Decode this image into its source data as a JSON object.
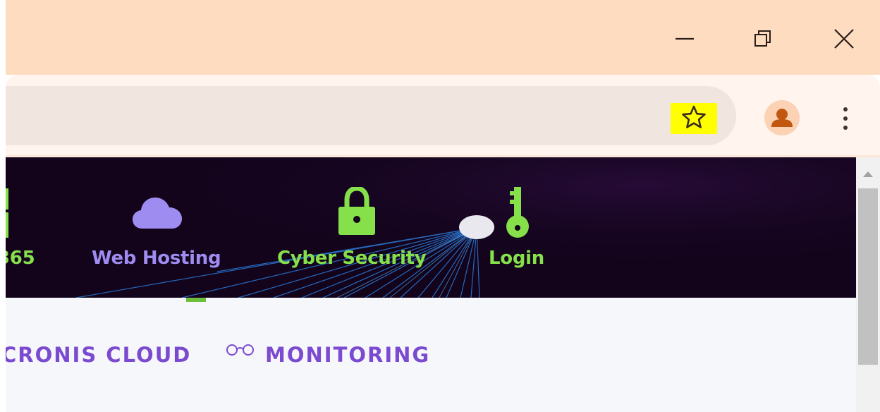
{
  "window_controls": {
    "minimize_icon": "minimize-icon",
    "restore_icon": "restore-icon",
    "close_icon": "close-icon"
  },
  "toolbar": {
    "bookmark_icon": "star-icon",
    "profile_icon": "profile-avatar-icon",
    "menu_icon": "kebab-menu-icon"
  },
  "nav": {
    "items": [
      {
        "label": "365",
        "icon": "grid-icon",
        "color": "#86e04a"
      },
      {
        "label": "Web Hosting",
        "icon": "cloud-icon",
        "color": "#9f8cf1"
      },
      {
        "label": "Cyber Security",
        "icon": "lock-icon",
        "color": "#86e04a"
      },
      {
        "label": "Login",
        "icon": "key-icon",
        "color": "#86e04a"
      }
    ]
  },
  "submenu": {
    "items": [
      {
        "label": "CRONIS CLOUD"
      },
      {
        "label": "MONITORING",
        "icon": "glasses-icon"
      }
    ]
  },
  "colors": {
    "titlebar": "#fddcc0",
    "banner_bg": "#13041c",
    "accent_green": "#86e04a",
    "accent_purple": "#9f8cf1",
    "submenu_purple": "#7b4ad0",
    "highlight": "#ffff00"
  }
}
